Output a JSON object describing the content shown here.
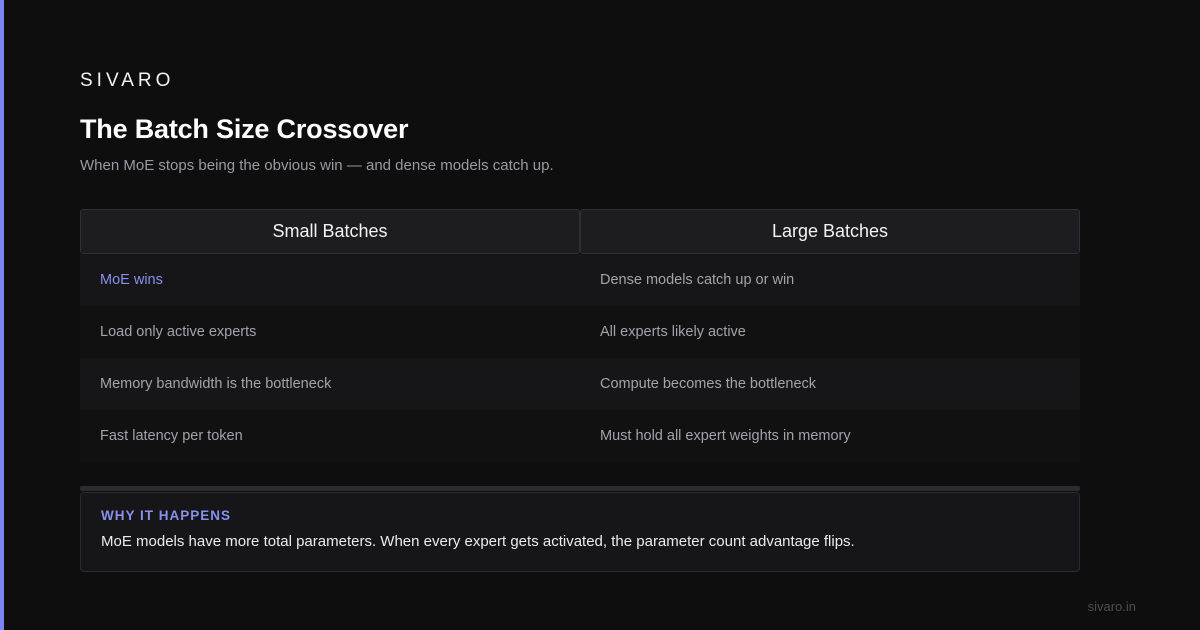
{
  "brand": "SIVARO",
  "title": "The Batch Size Crossover",
  "subtitle": "When MoE stops being the obvious win — and dense models catch up.",
  "colors": {
    "background": "#0e0e0f",
    "accent": "#7b84f0",
    "highlight_text": "#8990ee"
  },
  "table": {
    "headers": [
      "Small Batches",
      "Large Batches"
    ],
    "rows": [
      [
        "MoE wins",
        "Dense models catch up or win"
      ],
      [
        "Load only active experts",
        "All experts likely active"
      ],
      [
        "Memory bandwidth is the bottleneck",
        "Compute becomes the bottleneck"
      ],
      [
        "Fast latency per token",
        "Must hold all expert weights in memory"
      ]
    ]
  },
  "why": {
    "label": "WHY IT HAPPENS",
    "text": "MoE models have more total parameters. When every expert gets activated, the parameter count advantage flips."
  },
  "footer": "sivaro.in"
}
